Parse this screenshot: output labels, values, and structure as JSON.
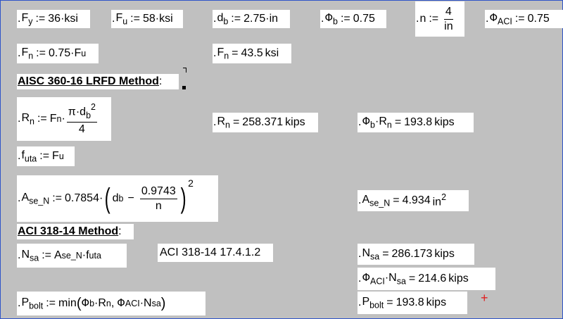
{
  "fy": {
    "sym": "F",
    "sub": "y",
    "op": ":=",
    "val": "36",
    "dot": "·",
    "unit": "ksi"
  },
  "fu": {
    "sym": "F",
    "sub": "u",
    "op": ":=",
    "val": "58",
    "dot": "·",
    "unit": "ksi"
  },
  "db": {
    "sym": "d",
    "sub": "b",
    "op": ":=",
    "val": "2.75",
    "dot": "·",
    "unit": "in"
  },
  "phib": {
    "sym": "Φ",
    "sub": "b",
    "op": ":=",
    "val": "0.75"
  },
  "n": {
    "sym": "n",
    "op": ":=",
    "num": "4",
    "den": "in"
  },
  "phiaci": {
    "sym": "Φ",
    "sub": "ACI",
    "op": ":=",
    "val": "0.75"
  },
  "fn_def": {
    "sym": "F",
    "sub": "n",
    "op": ":=",
    "coef": "0.75",
    "dot": "·",
    "rsym": "F",
    "rsub": "u"
  },
  "fn_res": {
    "sym": "F",
    "sub": "n",
    "op": "=",
    "val": "43.5",
    "unit": "ksi"
  },
  "aisc_heading": "AISC 360-16 LRFD Method",
  "aisc_colon": ":",
  "rn_def": {
    "sym": "R",
    "sub": "n",
    "op": ":=",
    "f": "F",
    "fsub": "n",
    "dot": "·",
    "num_a": "π·d",
    "num_sub": "b",
    "num_sup": "2",
    "den": "4"
  },
  "rn_res": {
    "sym": "R",
    "sub": "n",
    "op": "=",
    "val": "258.371",
    "unit": "kips"
  },
  "phibrn_res": {
    "sym": "Φ",
    "sub": "b",
    "dot": "·",
    "sym2": "R",
    "sub2": "n",
    "op": "=",
    "val": "193.8",
    "unit": "kips"
  },
  "futa": {
    "sym": "f",
    "sub": "uta",
    "op": ":=",
    "rsym": "F",
    "rsub": "u"
  },
  "ase_def": {
    "sym": "A",
    "sub": "se_N",
    "op": ":=",
    "coef": "0.7854",
    "dot": "·",
    "lp": "(",
    "d": "d",
    "dsub": "b",
    "minus": "−",
    "num": "0.9743",
    "den": "n",
    "rp": ")",
    "pow": "2"
  },
  "ase_res": {
    "sym": "A",
    "sub": "se_N",
    "op": "=",
    "val": "4.934",
    "unit": "in",
    "unit_sup": "2"
  },
  "aci_heading": "ACI 318-14 Method",
  "aci_colon": ":",
  "nsa_def": {
    "sym": "N",
    "sub": "sa",
    "op": ":=",
    "a": "A",
    "asub": "se_N",
    "dot": "·",
    "f": "f",
    "fsub": "uta"
  },
  "aci_ref": "ACI 318-14 17.4.1.2",
  "nsa_res": {
    "sym": "N",
    "sub": "sa",
    "op": "=",
    "val": "286.173",
    "unit": "kips"
  },
  "phinsa_res": {
    "sym": "Φ",
    "sub": "ACI",
    "dot": "·",
    "sym2": "N",
    "sub2": "sa",
    "op": "=",
    "val": "214.6",
    "unit": "kips"
  },
  "pbolt_def": {
    "sym": "P",
    "sub": "bolt",
    "op": ":=",
    "fn": "min",
    "lp": "(",
    "p1": "Φ",
    "p1sub": "b",
    "dot": "·",
    "p2": "R",
    "p2sub": "n",
    "comma": ",",
    "p3": "Φ",
    "p3sub": "ACI",
    "p4": "N",
    "p4sub": "sa",
    "rp": ")"
  },
  "pbolt_res": {
    "sym": "P",
    "sub": "bolt",
    "op": "=",
    "val": "193.8",
    "unit": "kips"
  },
  "colors": {
    "background": "#c0c0c0",
    "region": "#ffffff",
    "frame": "#2f55c8",
    "cursor_mark": "#e02020"
  },
  "leading_dot": "."
}
